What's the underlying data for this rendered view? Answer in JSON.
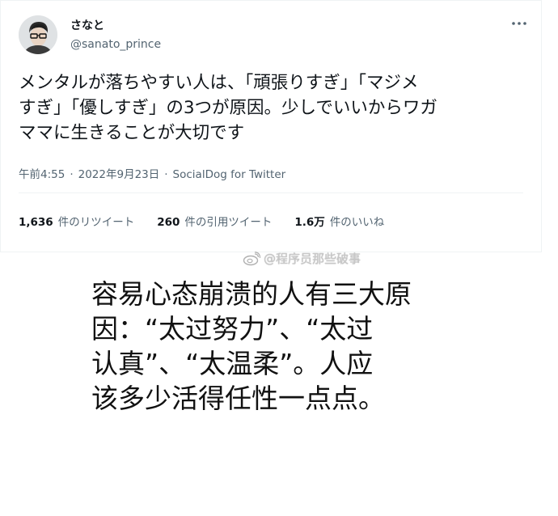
{
  "tweet": {
    "author": {
      "display_name": "さなと",
      "handle": "@sanato_prince"
    },
    "more_icon": "more-dots-icon",
    "text_lines": [
      "メンタルが落ちやすい人は、「頑張りすぎ」「マジメ",
      "すぎ」「優しすぎ」の3つが原因。少しでいいからワガ",
      "ママに生きることが大切です"
    ],
    "time": "午前4:55",
    "separator": "·",
    "date": "2022年9月23日",
    "source": "SocialDog for Twitter",
    "stats": [
      {
        "count": "1,636",
        "label": "件のリツイート"
      },
      {
        "count": "260",
        "label": "件の引用ツイート"
      },
      {
        "count": "1.6万",
        "label": "件のいいね"
      }
    ]
  },
  "watermark": {
    "text": "@程序员那些破事",
    "icon": "weibo-icon"
  },
  "caption_lines": [
    "容易心态崩溃的人有三大原",
    "因：“太过努力”、“太过",
    "认真”、“太温柔”。人应",
    "该多少活得任性一点点。"
  ],
  "colors": {
    "text_primary": "#0f1419",
    "text_secondary": "#536471",
    "border": "#eff3f4",
    "watermark": "#c8c8c8"
  }
}
